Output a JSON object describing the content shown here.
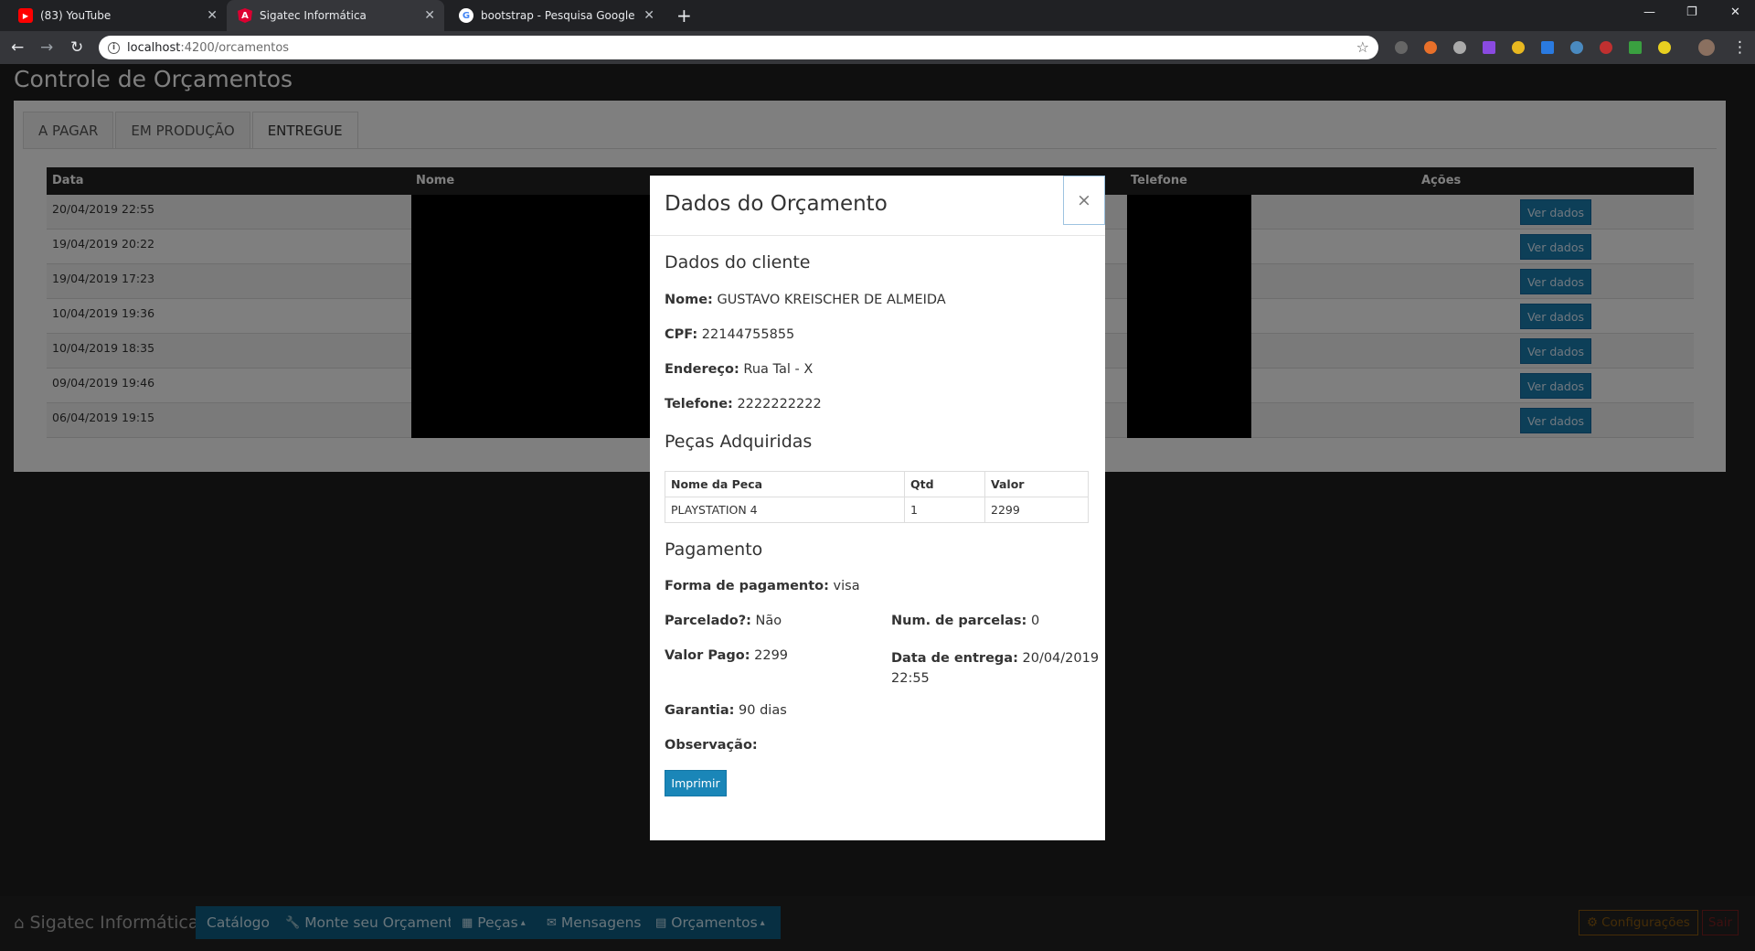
{
  "browser": {
    "tabs": [
      {
        "title": "(83) YouTube"
      },
      {
        "title": "Sigatec Informática"
      },
      {
        "title": "bootstrap - Pesquisa Google"
      }
    ],
    "url_host": "localhost",
    "url_path": ":4200/orcamentos"
  },
  "page": {
    "title": "Controle de Orçamentos",
    "tabs": [
      "A PAGAR",
      "EM PRODUÇÃO",
      "ENTREGUE"
    ],
    "table": {
      "headers": [
        "Data",
        "Nome",
        "Telefone",
        "Ações"
      ],
      "rows": [
        {
          "date": "20/04/2019 22:55",
          "action": "Ver dados"
        },
        {
          "date": "19/04/2019 20:22",
          "action": "Ver dados"
        },
        {
          "date": "19/04/2019 17:23",
          "action": "Ver dados"
        },
        {
          "date": "10/04/2019 19:36",
          "action": "Ver dados"
        },
        {
          "date": "10/04/2019 18:35",
          "action": "Ver dados"
        },
        {
          "date": "09/04/2019 19:46",
          "action": "Ver dados"
        },
        {
          "date": "06/04/2019 19:15",
          "action": "Ver dados"
        }
      ]
    }
  },
  "modal": {
    "title": "Dados do Orçamento",
    "close": "×",
    "cliente_heading": "Dados do cliente",
    "nome_label": "Nome:",
    "nome": "GUSTAVO KREISCHER DE ALMEIDA",
    "cpf_label": "CPF:",
    "cpf": "22144755855",
    "endereco_label": "Endereço:",
    "endereco": "Rua Tal - X",
    "telefone_label": "Telefone:",
    "telefone": "2222222222",
    "pecas_heading": "Peças Adquiridas",
    "pecas_headers": [
      "Nome da Peca",
      "Qtd",
      "Valor"
    ],
    "pecas_rows": [
      [
        "PLAYSTATION 4",
        "1",
        "2299"
      ]
    ],
    "pagamento_heading": "Pagamento",
    "forma_label": "Forma de pagamento:",
    "forma": "visa",
    "parcelado_label": "Parcelado?:",
    "parcelado": "Não",
    "num_parcelas_label": "Num. de parcelas:",
    "num_parcelas": "0",
    "valor_pago_label": "Valor Pago:",
    "valor_pago": "2299",
    "data_entrega_label": "Data de entrega:",
    "data_entrega_1": "20/04/2019",
    "data_entrega_2": "22:55",
    "garantia_label": "Garantia:",
    "garantia": "90 dias",
    "observacao_label": "Observação:",
    "imprimir": "Imprimir"
  },
  "footer": {
    "brand": "Sigatec Informática",
    "buttons": [
      "Catálogo",
      "Monte seu Orçamento",
      "Peças",
      "Mensagens",
      "Orçamentos"
    ],
    "config": "Configurações",
    "sair": "Sair"
  },
  "colors": {
    "accent": "#1a7fb0",
    "dark": "#222222"
  }
}
